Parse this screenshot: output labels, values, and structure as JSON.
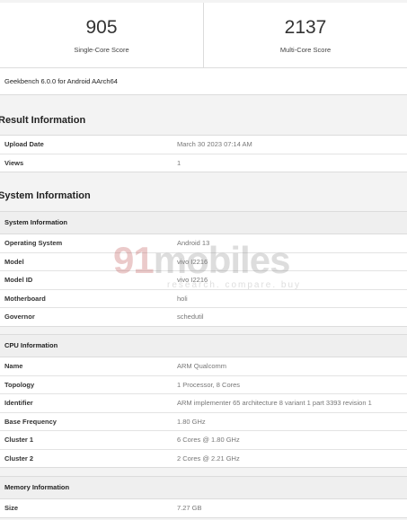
{
  "scores": {
    "single": {
      "value": "905",
      "label": "Single-Core Score"
    },
    "multi": {
      "value": "2137",
      "label": "Multi-Core Score"
    }
  },
  "version": "Geekbench 6.0.0 for Android AArch64",
  "result": {
    "title": "Result Information",
    "rows": [
      {
        "k": "Upload Date",
        "v": "March 30 2023 07:14 AM"
      },
      {
        "k": "Views",
        "v": "1"
      }
    ]
  },
  "system": {
    "title": "System Information",
    "sys_table": {
      "header": "System Information",
      "rows": [
        {
          "k": "Operating System",
          "v": "Android 13"
        },
        {
          "k": "Model",
          "v": "vivo I2216"
        },
        {
          "k": "Model ID",
          "v": "vivo I2216"
        },
        {
          "k": "Motherboard",
          "v": "holi"
        },
        {
          "k": "Governor",
          "v": "schedutil"
        }
      ]
    },
    "cpu_table": {
      "header": "CPU Information",
      "rows": [
        {
          "k": "Name",
          "v": "ARM Qualcomm"
        },
        {
          "k": "Topology",
          "v": "1 Processor, 8 Cores"
        },
        {
          "k": "Identifier",
          "v": "ARM implementer 65 architecture 8 variant 1 part 3393 revision 1"
        },
        {
          "k": "Base Frequency",
          "v": "1.80 GHz"
        },
        {
          "k": "Cluster 1",
          "v": "6 Cores @ 1.80 GHz"
        },
        {
          "k": "Cluster 2",
          "v": "2 Cores @ 2.21 GHz"
        }
      ]
    },
    "mem_table": {
      "header": "Memory Information",
      "rows": [
        {
          "k": "Size",
          "v": "7.27 GB"
        }
      ]
    }
  },
  "watermark": {
    "main_a": "91",
    "main_b": "mobiles",
    "sub": "research. compare. buy"
  }
}
